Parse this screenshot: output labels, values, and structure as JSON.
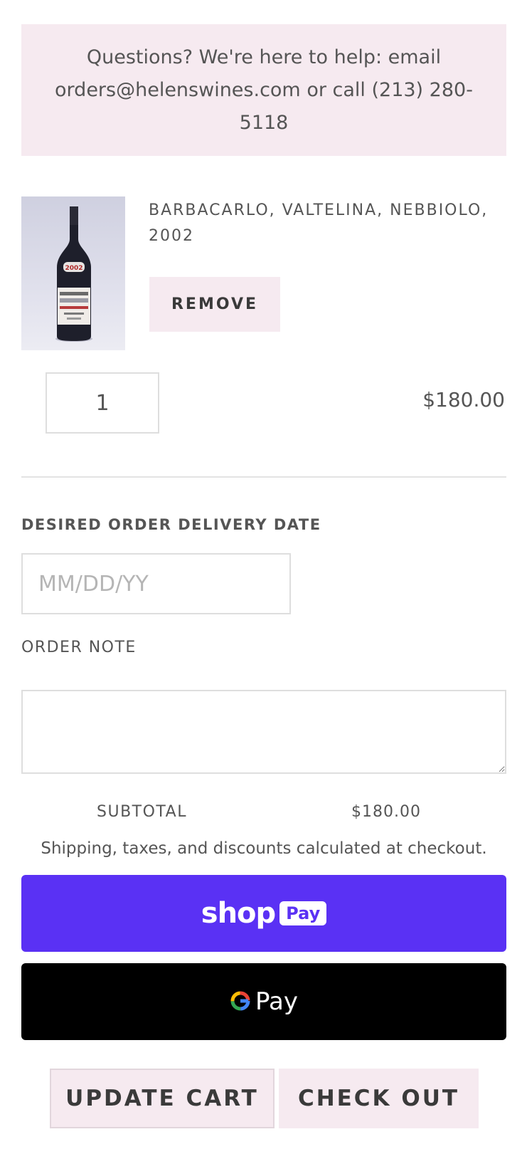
{
  "help": {
    "text": "Questions? We're here to help: email orders@helenswines.com or call (213) 280-5118"
  },
  "cart_item": {
    "image_alt": "wine-bottle-photo",
    "name": "BARBACARLO, VALTELINA, NEBBIOLO, 2002",
    "remove_label": "REMOVE",
    "quantity": "1",
    "price": "$180.00"
  },
  "delivery": {
    "label": "DESIRED ORDER DELIVERY DATE",
    "placeholder": "MM/DD/YY"
  },
  "note": {
    "label": "ORDER NOTE",
    "value": ""
  },
  "summary": {
    "subtotal_label": "SUBTOTAL",
    "subtotal_value": "$180.00",
    "shipping_note": "Shipping, taxes, and discounts calculated at checkout."
  },
  "express": {
    "shop_word": "shop",
    "shop_badge": "Pay",
    "gpay_word": "Pay"
  },
  "actions": {
    "update_label": "UPDATE CART",
    "checkout_label": "CHECK OUT"
  },
  "colors": {
    "accent_pink": "#f6eaf0",
    "shop_pay_purple": "#5a31f4",
    "gpay_black": "#000000"
  }
}
